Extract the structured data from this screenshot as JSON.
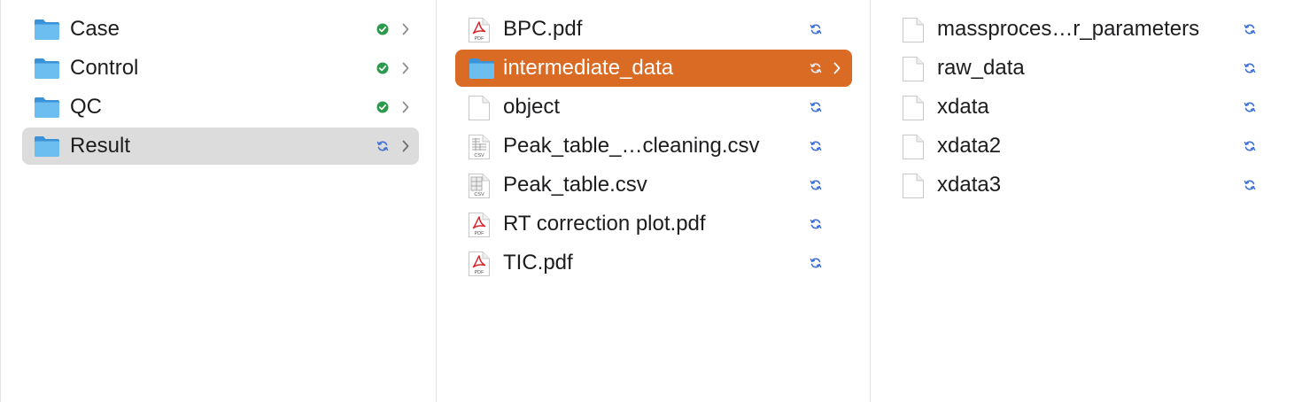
{
  "columns": {
    "left": {
      "items": [
        {
          "label": "Case",
          "icon": "folder-icon",
          "status": "synced-check-icon"
        },
        {
          "label": "Control",
          "icon": "folder-icon",
          "status": "synced-check-icon"
        },
        {
          "label": "QC",
          "icon": "folder-icon",
          "status": "synced-check-icon"
        },
        {
          "label": "Result",
          "icon": "folder-icon",
          "status": "syncing-icon",
          "selected": true
        }
      ]
    },
    "middle": {
      "items": [
        {
          "label": "BPC.pdf",
          "icon": "pdf-icon",
          "status": "syncing-icon"
        },
        {
          "label": "intermediate_data",
          "icon": "folder-icon",
          "status": "syncing-icon",
          "selected": true
        },
        {
          "label": "object",
          "icon": "document-icon",
          "status": "syncing-icon"
        },
        {
          "label": "Peak_table_…cleaning.csv",
          "icon": "csv-icon",
          "status": "syncing-icon"
        },
        {
          "label": "Peak_table.csv",
          "icon": "csv-icon",
          "status": "syncing-icon"
        },
        {
          "label": "RT correction plot.pdf",
          "icon": "pdf-icon",
          "status": "syncing-icon"
        },
        {
          "label": "TIC.pdf",
          "icon": "pdf-icon",
          "status": "syncing-icon"
        }
      ]
    },
    "right": {
      "items": [
        {
          "label": "massproces…r_parameters",
          "icon": "document-icon",
          "status": "syncing-icon"
        },
        {
          "label": "raw_data",
          "icon": "document-icon",
          "status": "syncing-icon"
        },
        {
          "label": "xdata",
          "icon": "document-icon",
          "status": "syncing-icon"
        },
        {
          "label": "xdata2",
          "icon": "document-icon",
          "status": "syncing-icon"
        },
        {
          "label": "xdata3",
          "icon": "document-icon",
          "status": "syncing-icon"
        }
      ]
    }
  },
  "colors": {
    "selection_orange": "#d96b25",
    "selection_gray": "#dcdcdc",
    "sync_blue": "#3d6fd6",
    "check_green": "#2c9a4c",
    "folder_blue": "#5fb4ee",
    "pdf_red": "#d8262b"
  }
}
